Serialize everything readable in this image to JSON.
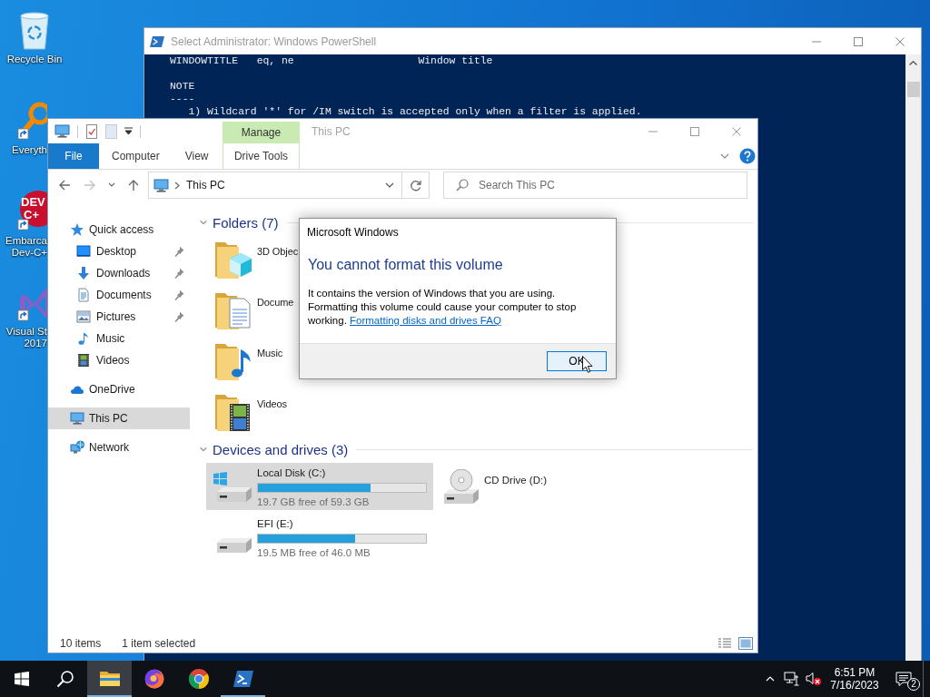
{
  "desktop": {
    "icons": [
      {
        "kind": "recycle-bin",
        "label": [
          "Recycle Bin"
        ],
        "partly_hidden": false
      },
      {
        "kind": "everything",
        "label": [
          "Everyth"
        ],
        "partly_hidden": true
      },
      {
        "kind": "dev-cpp",
        "label": [
          "Embarca",
          "Dev-C+"
        ],
        "logo_text": [
          "DEV",
          "C+"
        ],
        "partly_hidden": true
      },
      {
        "kind": "visual-studio",
        "label": [
          "Visual St",
          "2017"
        ],
        "partly_hidden": true
      }
    ]
  },
  "powershell": {
    "title": "Select Administrator: Windows PowerShell",
    "paragraphs": [
      [
        {
          "kind": "plain",
          "text": "WINDOWTITLE   eq, ne                    Window title"
        }
      ],
      [
        {
          "kind": "plain",
          "text": "NOTE"
        },
        {
          "kind": "plain",
          "text": "----"
        },
        {
          "kind": "item",
          "text": "1) Wildcard '*' for /IM switch is accepted only when a filter is applied."
        }
      ]
    ]
  },
  "explorer": {
    "title": "This PC",
    "ribbon": {
      "context_group": "Manage",
      "tabs": [
        {
          "label": "File",
          "kind": "file",
          "selected": false
        },
        {
          "label": "Computer",
          "kind": "plain",
          "selected": false
        },
        {
          "label": "View",
          "kind": "plain",
          "selected": false
        },
        {
          "label": "Drive Tools",
          "kind": "contextual",
          "selected": false
        }
      ]
    },
    "nav_buttons": [
      {
        "kind": "back",
        "disabled": false
      },
      {
        "kind": "forward",
        "disabled": true
      },
      {
        "kind": "recent",
        "disabled": false
      },
      {
        "kind": "up",
        "disabled": false
      }
    ],
    "address": {
      "path": "This PC"
    },
    "search": {
      "placeholder": "Search This PC"
    },
    "navigation": [
      {
        "label": "Quick access",
        "kind": "quick-access",
        "selected": false,
        "children": [
          {
            "label": "Desktop",
            "kind": "desktop",
            "pinned": true,
            "selected": false
          },
          {
            "label": "Downloads",
            "kind": "downloads",
            "pinned": true,
            "selected": false
          },
          {
            "label": "Documents",
            "kind": "documents",
            "pinned": true,
            "selected": false
          },
          {
            "label": "Pictures",
            "kind": "pictures",
            "pinned": true,
            "selected": false
          },
          {
            "label": "Music",
            "kind": "music",
            "pinned": false,
            "selected": false
          },
          {
            "label": "Videos",
            "kind": "videos",
            "pinned": false,
            "selected": false
          }
        ]
      },
      {
        "label": "OneDrive",
        "kind": "onedrive",
        "selected": false
      },
      {
        "label": "This PC",
        "kind": "this-pc",
        "selected": true
      },
      {
        "label": "Network",
        "kind": "network",
        "selected": false
      }
    ],
    "sections": [
      {
        "title": "Folders (7)",
        "kind": "folders",
        "expanded": true,
        "items": [
          {
            "label": "3D Objec",
            "kind": "objects",
            "selected": false
          },
          {
            "label": "Docume",
            "kind": "documents",
            "selected": false
          },
          {
            "label": "Music",
            "kind": "music",
            "selected": false
          },
          {
            "label": "Videos",
            "kind": "videos",
            "selected": false
          }
        ]
      },
      {
        "title": "Devices and drives (3)",
        "kind": "drives",
        "expanded": true,
        "items": [
          {
            "label": "Local Disk (C:)",
            "kind": "system-disk",
            "selected": true,
            "level": 0.668,
            "free": "19.7 GB free of 59.3 GB"
          },
          {
            "label": "CD Drive (D:)",
            "kind": "cd-drive",
            "selected": false
          },
          {
            "label": "EFI (E:)",
            "kind": "disk",
            "selected": false,
            "level": 0.576,
            "free": "19.5 MB free of 46.0 MB"
          }
        ]
      }
    ],
    "status": {
      "count": "10 items",
      "selection": "1 item selected"
    }
  },
  "dialog": {
    "title": "Microsoft Windows",
    "heading": "You cannot format this volume",
    "message": "It contains the version of Windows that you are using. Formatting this volume could cause your computer to stop working.",
    "link": "Formatting disks and drives FAQ",
    "buttons": [
      {
        "label": "OK",
        "focused": true
      }
    ]
  },
  "taskbar": {
    "apps": [
      {
        "kind": "explorer",
        "active": true,
        "running": true
      },
      {
        "kind": "firefox",
        "active": false,
        "running": false
      },
      {
        "kind": "chrome",
        "active": false,
        "running": false
      },
      {
        "kind": "powershell",
        "active": false,
        "running": true
      }
    ],
    "volume_muted": true,
    "time": "6:51 PM",
    "date": "7/16/2023",
    "notification_count": "2"
  }
}
